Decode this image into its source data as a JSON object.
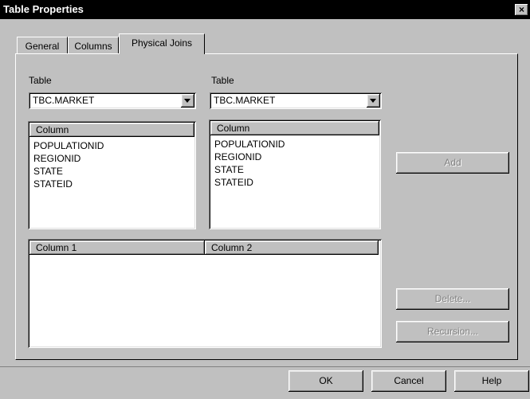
{
  "window": {
    "title": "Table Properties",
    "close_glyph": "×"
  },
  "tabs": [
    {
      "label": "General"
    },
    {
      "label": "Columns"
    },
    {
      "label": "Physical Joins"
    }
  ],
  "left": {
    "table_label": "Table",
    "table_value": "TBC.MARKET",
    "column_header": "Column",
    "columns": [
      "POPULATIONID",
      "REGIONID",
      "STATE",
      "STATEID"
    ]
  },
  "right": {
    "table_label": "Table",
    "table_value": "TBC.MARKET",
    "column_header": "Column",
    "columns": [
      "POPULATIONID",
      "REGIONID",
      "STATE",
      "STATEID"
    ]
  },
  "joins": {
    "column1_header": "Column 1",
    "column2_header": "Column 2"
  },
  "buttons": {
    "add": "Add",
    "delete": "Delete...",
    "recursion": "Recursion...",
    "ok": "OK",
    "cancel": "Cancel",
    "help": "Help"
  }
}
